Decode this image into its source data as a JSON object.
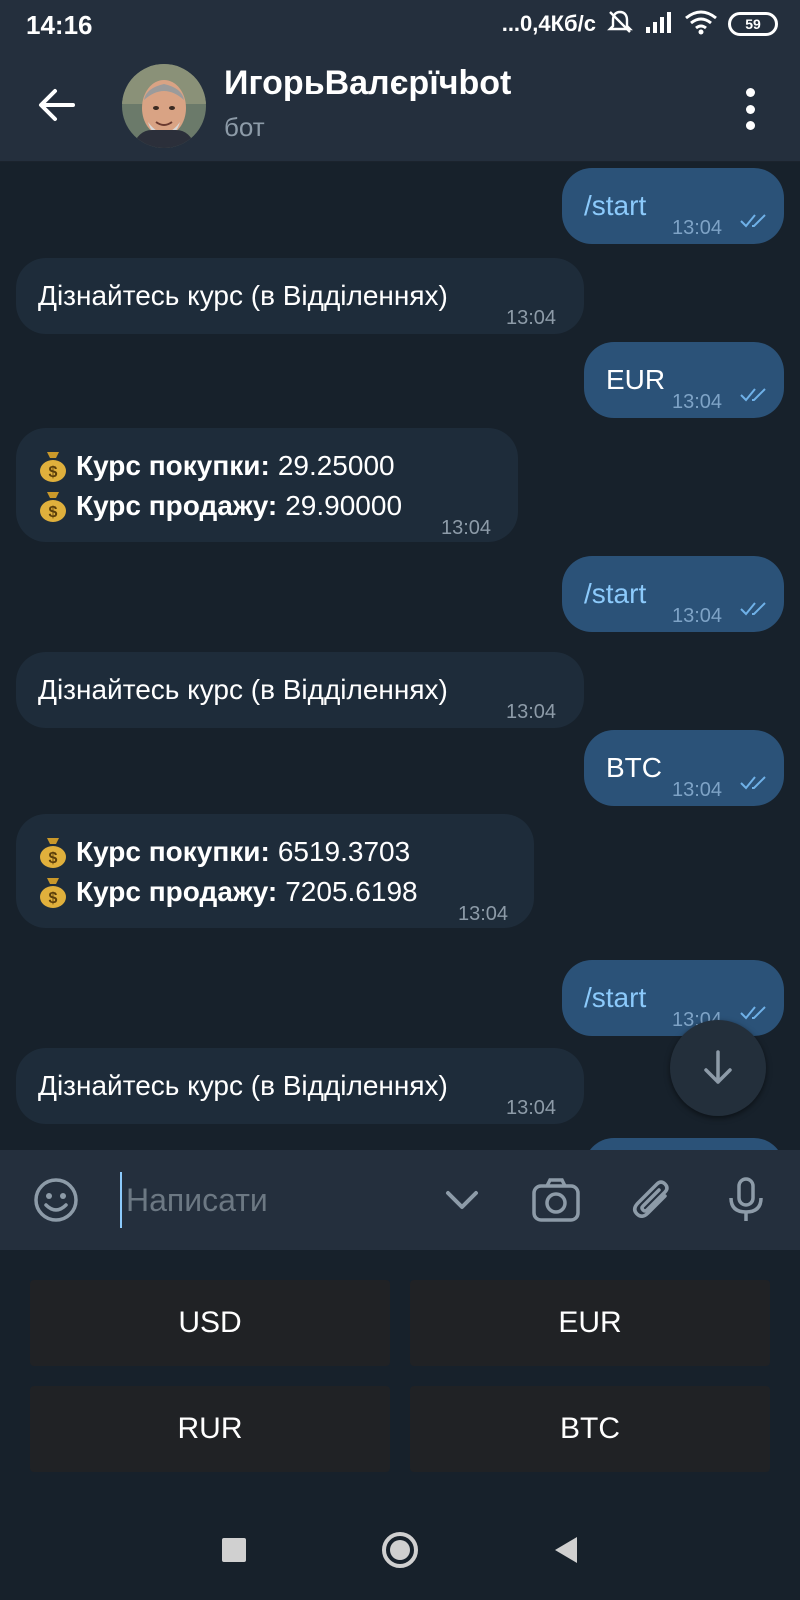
{
  "status_bar": {
    "time": "14:16",
    "network_speed": "...0,4Кб/с",
    "battery": "59"
  },
  "header": {
    "title": "ИгорьВалєрїчbot",
    "subtitle": "бот"
  },
  "messages": [
    {
      "direction": "out",
      "text": "/start",
      "time": "13:04"
    },
    {
      "direction": "in",
      "text": "Дізнайтесь курс (в Відділеннях)",
      "time": "13:04"
    },
    {
      "direction": "out",
      "text": "EUR",
      "time": "13:04"
    },
    {
      "direction": "in",
      "buy_label": "Курс покупки:",
      "buy_value": "29.25000",
      "sell_label": "Курс продажу:",
      "sell_value": "29.90000",
      "time": "13:04"
    },
    {
      "direction": "out",
      "text": "/start",
      "time": "13:04"
    },
    {
      "direction": "in",
      "text": "Дізнайтесь курс (в Відділеннях)",
      "time": "13:04"
    },
    {
      "direction": "out",
      "text": "BTC",
      "time": "13:04"
    },
    {
      "direction": "in",
      "buy_label": "Курс покупки:",
      "buy_value": "6519.3703",
      "sell_label": "Курс продажу:",
      "sell_value": "7205.6198",
      "time": "13:04"
    },
    {
      "direction": "out",
      "text": "/start",
      "time": "13:04"
    },
    {
      "direction": "in",
      "text": "Дізнайтесь курс (в Відділеннях)",
      "time": "13:04"
    }
  ],
  "input": {
    "placeholder": "Написати"
  },
  "keyboard": {
    "buttons": [
      "USD",
      "EUR",
      "RUR",
      "BTC"
    ]
  },
  "colors": {
    "background": "#17212b",
    "header": "#242f3d",
    "outgoing_bubble": "#2b5278",
    "incoming_bubble": "#1e2c3a",
    "accent": "#8ccafb"
  }
}
